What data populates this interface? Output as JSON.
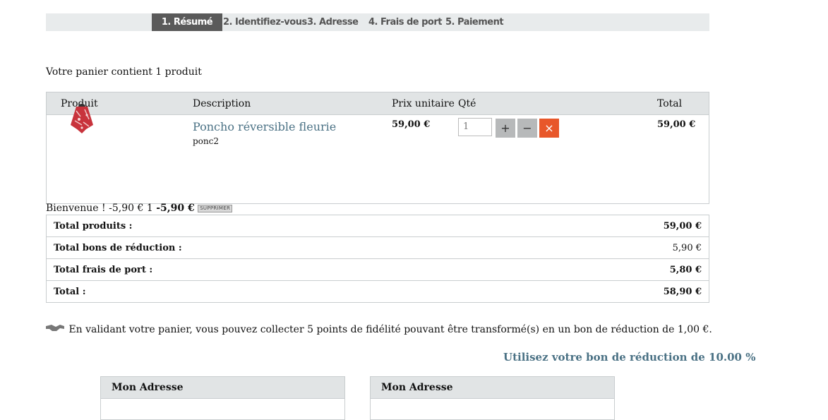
{
  "steps": [
    {
      "label": "1. Résumé",
      "active": true
    },
    {
      "label": "2. Identifiez-vous"
    },
    {
      "label": "3. Adresse"
    },
    {
      "label": "4. Frais de port"
    },
    {
      "label": "5. Paiement"
    }
  ],
  "cart": {
    "summary": "Votre panier contient 1 produit",
    "headers": {
      "product": "Produit",
      "description": "Description",
      "unit_price": "Prix unitaire",
      "qty": "Qté",
      "total": "Total"
    },
    "item": {
      "name": "Poncho réversible fleurie",
      "reference": "ponc2",
      "unit_price": "59,00 €",
      "quantity": "1",
      "total": "59,00 €",
      "image_icon": "red-poncho-product-image",
      "plus": "+",
      "minus": "−",
      "delete": "×"
    }
  },
  "voucher": {
    "name": "Bienvenue !",
    "amount": "-5,90 €",
    "qty": "1",
    "total": "-5,90 €",
    "remove_label": "SUPPRIMER"
  },
  "totals": [
    {
      "label": "Total produits :",
      "value": "59,00 €"
    },
    {
      "label": "Total bons de réduction :",
      "value": "5,90 €"
    },
    {
      "label": "Total frais de port :",
      "value": "5,80 €"
    },
    {
      "label": "Total :",
      "value": "58,90 €"
    }
  ],
  "loyalty": {
    "icon": "handshake-icon",
    "text": "En validant votre panier, vous pouvez collecter 5 points de fidélité pouvant être transformé(s) en un bon de réduction de 1,00 €."
  },
  "use_voucher_link": "Utilisez votre bon de réduction de 10.00 %",
  "addresses": [
    {
      "title": "Mon Adresse"
    },
    {
      "title": "Mon Adresse"
    }
  ],
  "colors": {
    "accent": "#4a7184",
    "delete_button": "#e8572a",
    "qty_button": "#b7b9ba",
    "header_bg": "#e1e4e5"
  }
}
